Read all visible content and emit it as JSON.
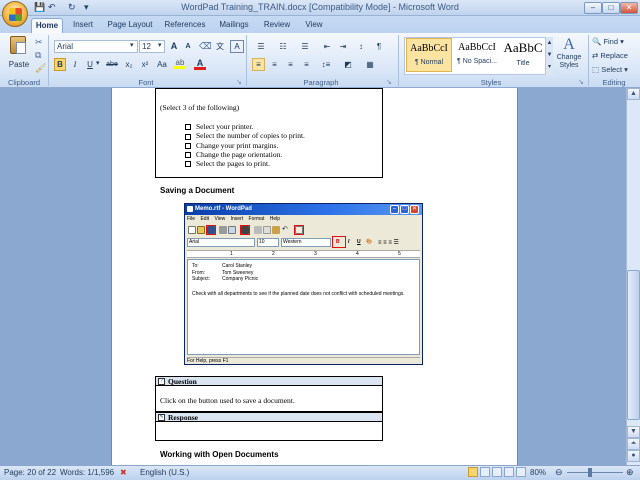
{
  "window": {
    "title": "WordPad Training_TRAIN.docx [Compatibility Mode] - Microsoft Word",
    "controls": {
      "minimize": "–",
      "maximize": "□",
      "close": "✕"
    }
  },
  "qat": {
    "save": "💾",
    "undo": "↶",
    "redo": "↻",
    "customize": "▾"
  },
  "tabs": [
    "Home",
    "Insert",
    "Page Layout",
    "References",
    "Mailings",
    "Review",
    "View"
  ],
  "ribbon": {
    "clipboard": {
      "label": "Clipboard",
      "paste": "Paste"
    },
    "font": {
      "label": "Font",
      "name": "Arial",
      "size": "12",
      "bold": "B",
      "italic": "I",
      "underline": "U",
      "strike": "abe",
      "sub": "x₂",
      "sup": "x²",
      "case": "Aa",
      "grow": "A",
      "shrink": "A",
      "clear": "A",
      "highlight_color": "#ffff00",
      "font_color": "#e01e1e"
    },
    "paragraph": {
      "label": "Paragraph",
      "pilcrow": "¶"
    },
    "styles": {
      "label": "Styles",
      "items": [
        {
          "preview": "AaBbCcI",
          "name": "¶ Normal"
        },
        {
          "preview": "AaBbCcI",
          "name": "¶ No Spaci..."
        },
        {
          "preview": "AaBbC",
          "name": "Title"
        }
      ],
      "change_styles": "Change Styles"
    },
    "editing": {
      "label": "Editing",
      "find": "Find",
      "replace": "Replace",
      "select": "Select"
    }
  },
  "document": {
    "instruction": "(Select 3 of the following)",
    "choices": [
      "Select your printer.",
      "Select the number of copies to print.",
      "Change your print margins.",
      "Change the page orientation.",
      "Select the pages to print."
    ],
    "heading_saving": "Saving a Document",
    "question_label": "Question",
    "question_text": "Click on the button used to save a document.",
    "response_label": "Response",
    "heading_open": "Working with Open Documents"
  },
  "wordpad": {
    "title": "Memo.rtf - WordPad",
    "menu": [
      "File",
      "Edit",
      "View",
      "Insert",
      "Format",
      "Help"
    ],
    "font": "Arial",
    "size": "10",
    "script": "Western",
    "memo": [
      {
        "k": "To:",
        "v": "Carol Stanley"
      },
      {
        "k": "From:",
        "v": "Tom Sweeney"
      },
      {
        "k": "Subject:",
        "v": "Company Picnic"
      }
    ],
    "body": "Check with all departments to see if the planned date does not conflict with scheduled meetings.",
    "status": "For Help, press F1",
    "ruler": [
      "1",
      "2",
      "3",
      "4",
      "5"
    ]
  },
  "status": {
    "page": "Page: 20 of 22",
    "words": "Words: 1/1,596",
    "language": "English (U.S.)",
    "zoom": "80%"
  }
}
